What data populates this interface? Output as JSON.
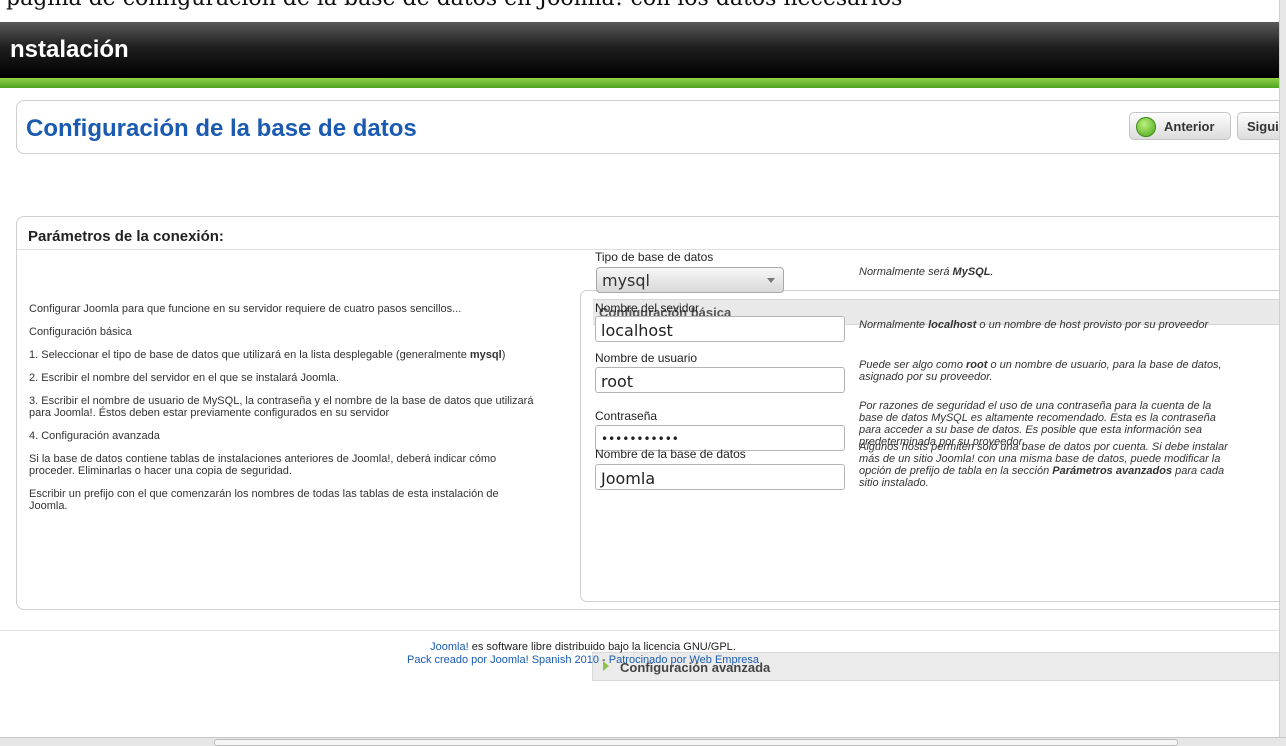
{
  "top_text": "página de configuración de la base de datos en Joomla! con los datos necesarios",
  "header": {
    "title": "nstalación"
  },
  "page": {
    "title": "Configuración de la base de datos",
    "prev_label": "Anterior",
    "next_label": "Siguie"
  },
  "section": {
    "title": "Parámetros de la conexión:"
  },
  "intro": {
    "p1": "Configurar Joomla para que funcione en su servidor requiere de cuatro pasos sencillos...",
    "p2": "Configuración básica",
    "p3_before": "1. Seleccionar el tipo de base de datos que utilizará en la lista desplegable (generalmente ",
    "p3_bold": "mysql",
    "p3_after": ")",
    "p4": "2. Escribir el nombre del servidor en el que se instalará Joomla.",
    "p5": "3. Escribir el nombre de usuario de MySQL, la contraseña y el nombre de la base de datos que utilizará para Joomla!. Éstos deben estar previamente configurados en su servidor",
    "p6": "4. Configuración avanzada",
    "p7": "Si la base de datos contiene tablas de instalaciones anteriores de Joomla!, deberá indicar cómo proceder. Eliminarlas o hacer una copia de seguridad.",
    "p8": "Escribir un prefijo con el que comenzarán los nombres de todas las tablas de esta instalación de Joomla."
  },
  "basic": {
    "header": "Configuración básica",
    "db_type_label": "Tipo de base de datos",
    "db_type_value": "mysql",
    "db_type_help_pre": "Normalmente será ",
    "db_type_help_bold": "MySQL",
    "db_type_help_post": ".",
    "host_label": "Nombre del sevidor",
    "host_value": "localhost",
    "host_help_pre": "Normalmente ",
    "host_help_bold": "localhost",
    "host_help_post": " o un nombre de host provisto por su proveedor",
    "user_label": "Nombre de usuario",
    "user_value": "root",
    "user_help_l1_pre": "Puede ser algo como ",
    "user_help_l1_bold": "root",
    "user_help_l1_post": " o un nombre de usuario, para la base de datos,",
    "user_help_l2": "asignado por su proveedor.",
    "pass_label": "Contraseña",
    "pass_value": "•••••••••••",
    "pass_help_l1": "Por razones de seguridad el uso de una contraseña para la cuenta de la",
    "pass_help_l2": "base de datos MySQL es altamente recomendado. Esta es la contraseña",
    "pass_help_l3": "para acceder a su base de datos. Es posible que esta información sea",
    "pass_help_l4": "predeterminada por su proveedor.",
    "dbname_label": "Nombre de la base de datos",
    "dbname_value": "Joomla",
    "dbname_help_l1": "Algunos hosts permiten solo una base de datos por cuenta. Si debe instalar",
    "dbname_help_l2": "más de un sitio Joomla! con una misma base de datos, puede modificar la",
    "dbname_help_l3_pre": "opción de prefijo de tabla en la sección ",
    "dbname_help_l3_bold": "Parámetros avanzados",
    "dbname_help_l3_post": " para cada",
    "dbname_help_l4": "sitio instalado."
  },
  "advanced": {
    "header": "Configuración avanzada"
  },
  "footer": {
    "l1_link": "Joomla!",
    "l1_text": " es software libre distribuido bajo la licencia GNU/GPL.",
    "l2_link1": "Pack creado por Joomla! Spanish 2010",
    "l2_sep": " - ",
    "l2_link2": "Patrocinado por Web Empresa"
  }
}
